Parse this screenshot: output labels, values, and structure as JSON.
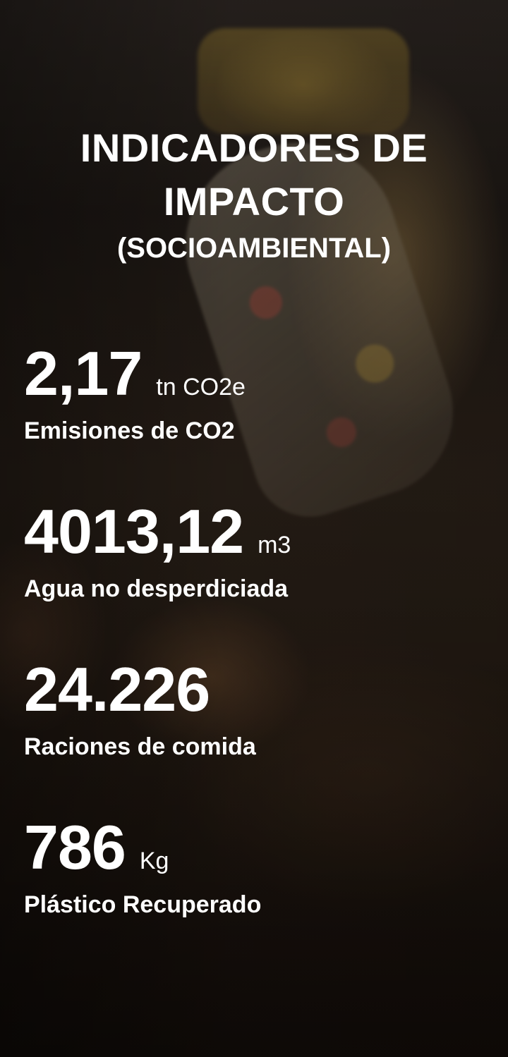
{
  "header": {
    "title": "INDICADORES DE IMPACTO",
    "subtitle": "(SOCIOAMBIENTAL)"
  },
  "metrics": [
    {
      "value": "2,17",
      "unit": "tn CO2e",
      "label": "Emisiones de CO2"
    },
    {
      "value": "4013,12",
      "unit": "m3",
      "label": "Agua no desperdiciada"
    },
    {
      "value": "24.226",
      "unit": "",
      "label": "Raciones de comida"
    },
    {
      "value": "786",
      "unit": "Kg",
      "label": "Plástico Recuperado"
    }
  ]
}
